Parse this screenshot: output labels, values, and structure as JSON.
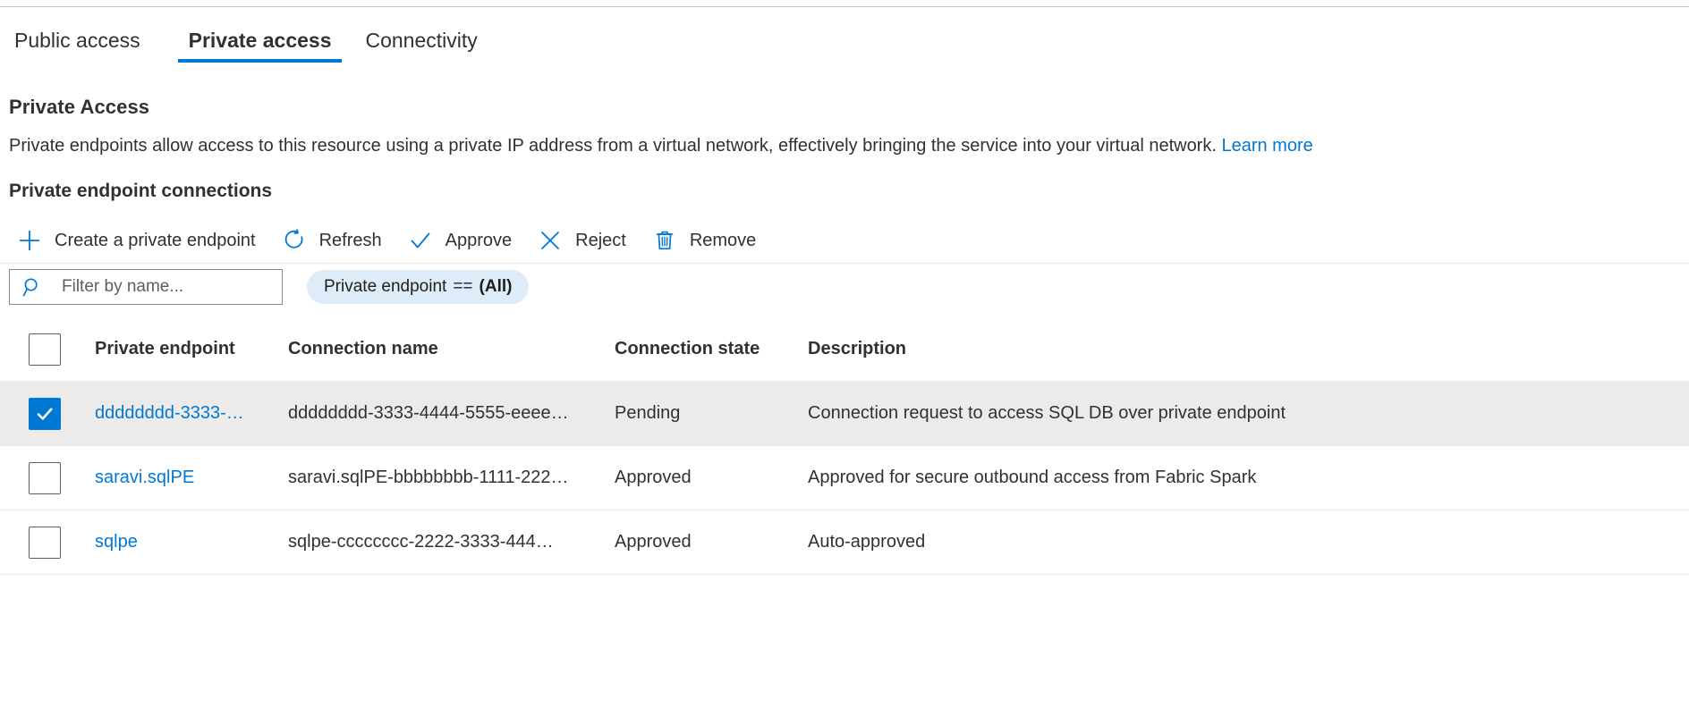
{
  "tabs": [
    {
      "label": "Public access",
      "selected": false
    },
    {
      "label": "Private access",
      "selected": true
    },
    {
      "label": "Connectivity",
      "selected": false
    }
  ],
  "section": {
    "title": "Private Access",
    "description": "Private endpoints allow access to this resource using a private IP address from a virtual network, effectively bringing the service into your virtual network.",
    "learn_more": "Learn more"
  },
  "subsection": {
    "title": "Private endpoint connections"
  },
  "toolbar": {
    "create_label": "Create a private endpoint",
    "refresh_label": "Refresh",
    "approve_label": "Approve",
    "reject_label": "Reject",
    "remove_label": "Remove"
  },
  "filters": {
    "search_placeholder": "Filter by name...",
    "search_value": "",
    "pill": {
      "field": "Private endpoint",
      "operator": "==",
      "value": "(All)"
    }
  },
  "table": {
    "columns": [
      "Private endpoint",
      "Connection name",
      "Connection state",
      "Description"
    ],
    "rows": [
      {
        "selected": true,
        "endpoint": "dddddddd-3333-…",
        "connection_name": "dddddddd-3333-4444-5555-eeee…",
        "state": "Pending",
        "description": "Connection request to access SQL DB over private endpoint"
      },
      {
        "selected": false,
        "endpoint": "saravi.sqlPE",
        "connection_name": "saravi.sqlPE-bbbbbbbb-1111-222…",
        "state": "Approved",
        "description": "Approved for secure outbound access from Fabric Spark"
      },
      {
        "selected": false,
        "endpoint": "sqlpe",
        "connection_name": "sqlpe-cccccccc-2222-3333-444…",
        "state": "Approved",
        "description": "Auto-approved"
      }
    ]
  },
  "colors": {
    "accent": "#0078d4",
    "selected_row": "#edebe9",
    "pill_bg": "#deecf9"
  }
}
